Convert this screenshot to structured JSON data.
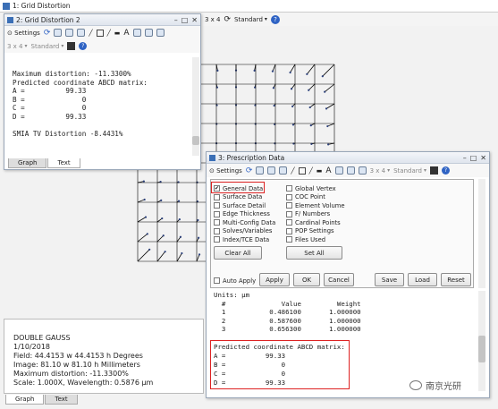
{
  "main": {
    "title": "1: Grid Distortion",
    "tool": {
      "layout": "3 x 4",
      "standard": "Standard"
    },
    "tabs": [
      "Graph",
      "Text"
    ],
    "info_lines": [
      "DOUBLE GAUSS",
      "1/10/2018",
      "Field: 44.4153 w 44.4153 h Degrees",
      "Image: 81.10 w 81.10 h Millimeters",
      "Maximum distortion: -11.3300%",
      "Scale: 1.000X, Wavelength: 0.5876 µm"
    ]
  },
  "grid_win": {
    "title": "2: Grid Distortion 2",
    "tool": {
      "settings": "Settings",
      "layout": "3 x 4",
      "standard": "Standard"
    },
    "text": "Maximum distortion: -11.3300%\nPredicted coordinate ABCD matrix:\nA =          99.33\nB =              0\nC =              0\nD =          99.33\n\nSMIA TV Distortion -8.4431%",
    "tabs": [
      "Graph",
      "Text"
    ]
  },
  "rx": {
    "title": "3: Prescription Data",
    "tool": {
      "settings": "Settings",
      "layout": "3 x 4",
      "standard": "Standard"
    },
    "col1": [
      "General Data",
      "Surface Data",
      "Surface Detail",
      "Edge Thickness",
      "Multi-Config Data",
      "Solves/Variables",
      "Index/TCE Data"
    ],
    "col2": [
      "Global Vertex",
      "COC Point",
      "Element Volume",
      "F/ Numbers",
      "Cardinal Points",
      "POP Settings",
      "Files Used"
    ],
    "checked": "General Data",
    "clear_all": "Clear All",
    "set_all": "Set All",
    "auto_apply": "Auto Apply",
    "buttons": {
      "apply": "Apply",
      "ok": "OK",
      "cancel": "Cancel",
      "save": "Save",
      "load": "Load",
      "reset": "Reset"
    },
    "text": "Units: µm\n  #              Value         Weight\n  1           0.486100       1.000000\n  2           0.587600       1.000000\n  3           0.656300       1.000000",
    "highlight": "Predicted coordinate ABCD matrix:\nA =          99.33\nB =              0\nC =              0\nD =          99.33"
  },
  "watermark": "南京光研",
  "colors": {
    "accent": "#3b6fb6",
    "highlight": "#d22222"
  }
}
